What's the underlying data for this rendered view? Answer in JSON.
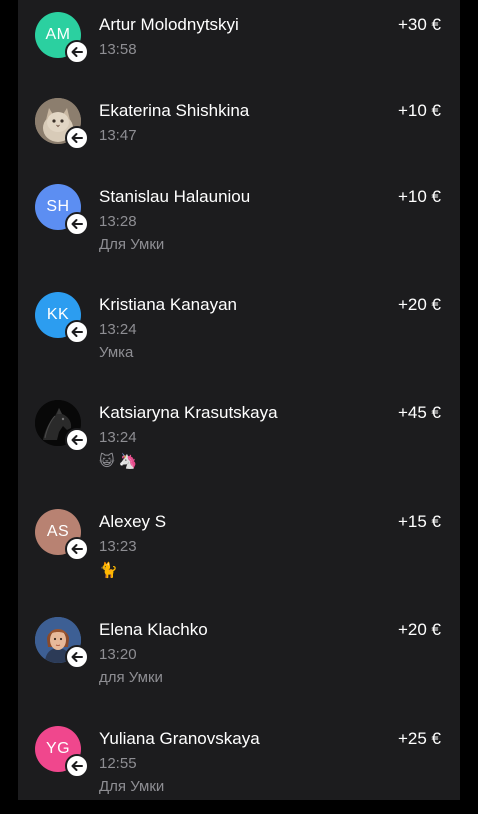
{
  "colors": {
    "background": "#000000",
    "panel": "#1c1c1e",
    "text_primary": "#ffffff",
    "text_secondary": "#8e8e93"
  },
  "transactions": [
    {
      "name": "Artur Molodnytskyi",
      "time": "13:58",
      "amount": "+30 €",
      "comment": "",
      "initials": "AM",
      "avatar_color": "#2bd0a0",
      "direction_icon": "incoming-arrow-icon"
    },
    {
      "name": "Ekaterina Shishkina",
      "time": "13:47",
      "amount": "+10 €",
      "comment": "",
      "initials": "",
      "avatar_color": "#9a8a78",
      "direction_icon": "incoming-arrow-icon"
    },
    {
      "name": "Stanislau Halauniou",
      "time": "13:28",
      "amount": "+10 €",
      "comment": "Для Умки",
      "initials": "SH",
      "avatar_color": "#5c8ef2",
      "direction_icon": "incoming-arrow-icon"
    },
    {
      "name": "Kristiana Kanayan",
      "time": "13:24",
      "amount": "+20 €",
      "comment": "Умка",
      "initials": "KK",
      "avatar_color": "#2c9df0",
      "direction_icon": "incoming-arrow-icon"
    },
    {
      "name": "Katsiaryna Krasutskaya",
      "time": "13:24",
      "amount": "+45 €",
      "comment": "😺 🦄",
      "initials": "",
      "avatar_color": "#0a0a0a",
      "direction_icon": "incoming-arrow-icon"
    },
    {
      "name": "Alexey S",
      "time": "13:23",
      "amount": "+15 €",
      "comment": "🐈",
      "initials": "AS",
      "avatar_color": "#b88272",
      "direction_icon": "incoming-arrow-icon"
    },
    {
      "name": "Elena Klachko",
      "time": "13:20",
      "amount": "+20 €",
      "comment": "для Умки",
      "initials": "",
      "avatar_color": "#4a6fa8",
      "direction_icon": "incoming-arrow-icon"
    },
    {
      "name": "Yuliana Granovskaya",
      "time": "12:55",
      "amount": "+25 €",
      "comment": "Для Умки",
      "initials": "YG",
      "avatar_color": "#f0478d",
      "direction_icon": "incoming-arrow-icon"
    }
  ]
}
